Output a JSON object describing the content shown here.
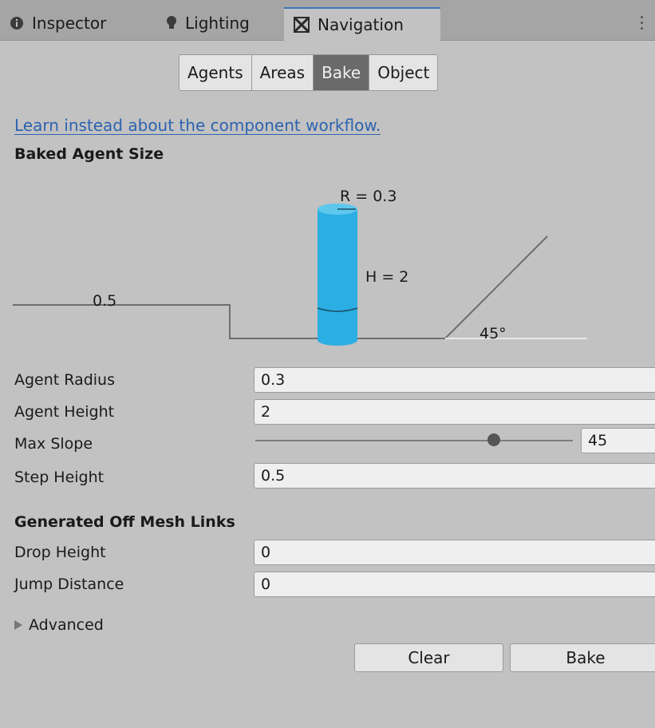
{
  "tabs": [
    {
      "label": "Inspector",
      "icon": "info-icon"
    },
    {
      "label": "Lighting",
      "icon": "lightbulb-icon"
    },
    {
      "label": "Navigation",
      "icon": "navigation-icon"
    }
  ],
  "active_tab": "Navigation",
  "segmented": [
    "Agents",
    "Areas",
    "Bake",
    "Object"
  ],
  "segmented_selected": "Bake",
  "link_text": "Learn instead about the component workflow.",
  "baked_agent_size": {
    "title": "Baked Agent Size",
    "radius_label": "R = 0.3",
    "height_label": "H = 2",
    "step_label": "0.5",
    "slope_label": "45°"
  },
  "fields": {
    "agent_radius": {
      "label": "Agent Radius",
      "value": "0.3"
    },
    "agent_height": {
      "label": "Agent Height",
      "value": "2"
    },
    "max_slope": {
      "label": "Max Slope",
      "value": "45",
      "fraction": 0.75
    },
    "step_height": {
      "label": "Step Height",
      "value": "0.5"
    }
  },
  "offmesh": {
    "title": "Generated Off Mesh Links",
    "drop_height": {
      "label": "Drop Height",
      "value": "0"
    },
    "jump_distance": {
      "label": "Jump Distance",
      "value": "0"
    }
  },
  "advanced_label": "Advanced",
  "buttons": {
    "clear": "Clear",
    "bake": "Bake"
  },
  "colors": {
    "agent": "#2aaee3",
    "link": "#2d63b0",
    "tab_accent": "#3a79bb"
  }
}
